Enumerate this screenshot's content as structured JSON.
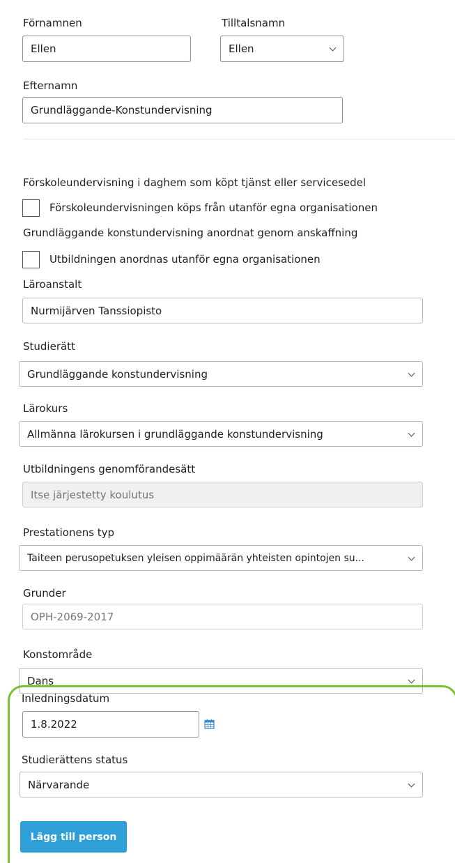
{
  "form": {
    "first_name": {
      "label": "Förnamnen",
      "value": "Ellen"
    },
    "calling_name": {
      "label": "Tilltalsnamn",
      "value": "Ellen"
    },
    "last_name": {
      "label": "Efternamn",
      "value": "Grundläggande-Konstundervisning"
    },
    "preschool": {
      "heading": "Förskoleundervisning i daghem som köpt tjänst eller servicesedel",
      "checkbox_label": "Förskoleundervisningen köps från utanför egna organisationen",
      "checked": false
    },
    "procurement": {
      "heading": "Grundläggande konstundervisning anordnat genom anskaffning",
      "checkbox_label": "Utbildningen anordnas utanför egna organisationen",
      "checked": false
    },
    "institution": {
      "label": "Läroanstalt",
      "value": "Nurmijärven Tanssiopisto"
    },
    "study_right": {
      "label": "Studierätt",
      "value": "Grundläggande konstundervisning"
    },
    "curriculum": {
      "label": "Lärokurs",
      "value": "Allmänna lärokursen i grundläggande konstundervisning"
    },
    "implementation": {
      "label": "Utbildningens genomförandesätt",
      "placeholder": "Itse järjestetty koulutus"
    },
    "achievement_type": {
      "label": "Prestationens typ",
      "value": "Taiteen perusopetuksen yleisen oppimäärän yhteisten opintojen su..."
    },
    "basis": {
      "label": "Grunder",
      "value": "OPH-2069-2017"
    },
    "art_field": {
      "label": "Konstområde",
      "value": "Dans"
    },
    "start_date": {
      "label": "Inledningsdatum",
      "value": "1.8.2022",
      "icon": "calendar-icon"
    },
    "status": {
      "label": "Studierättens status",
      "value": "Närvarande"
    },
    "submit_label": "Lägg till person"
  },
  "colors": {
    "accent": "#2f9fd8",
    "highlight": "#79c12e",
    "calendar": "#3b8fd0"
  }
}
